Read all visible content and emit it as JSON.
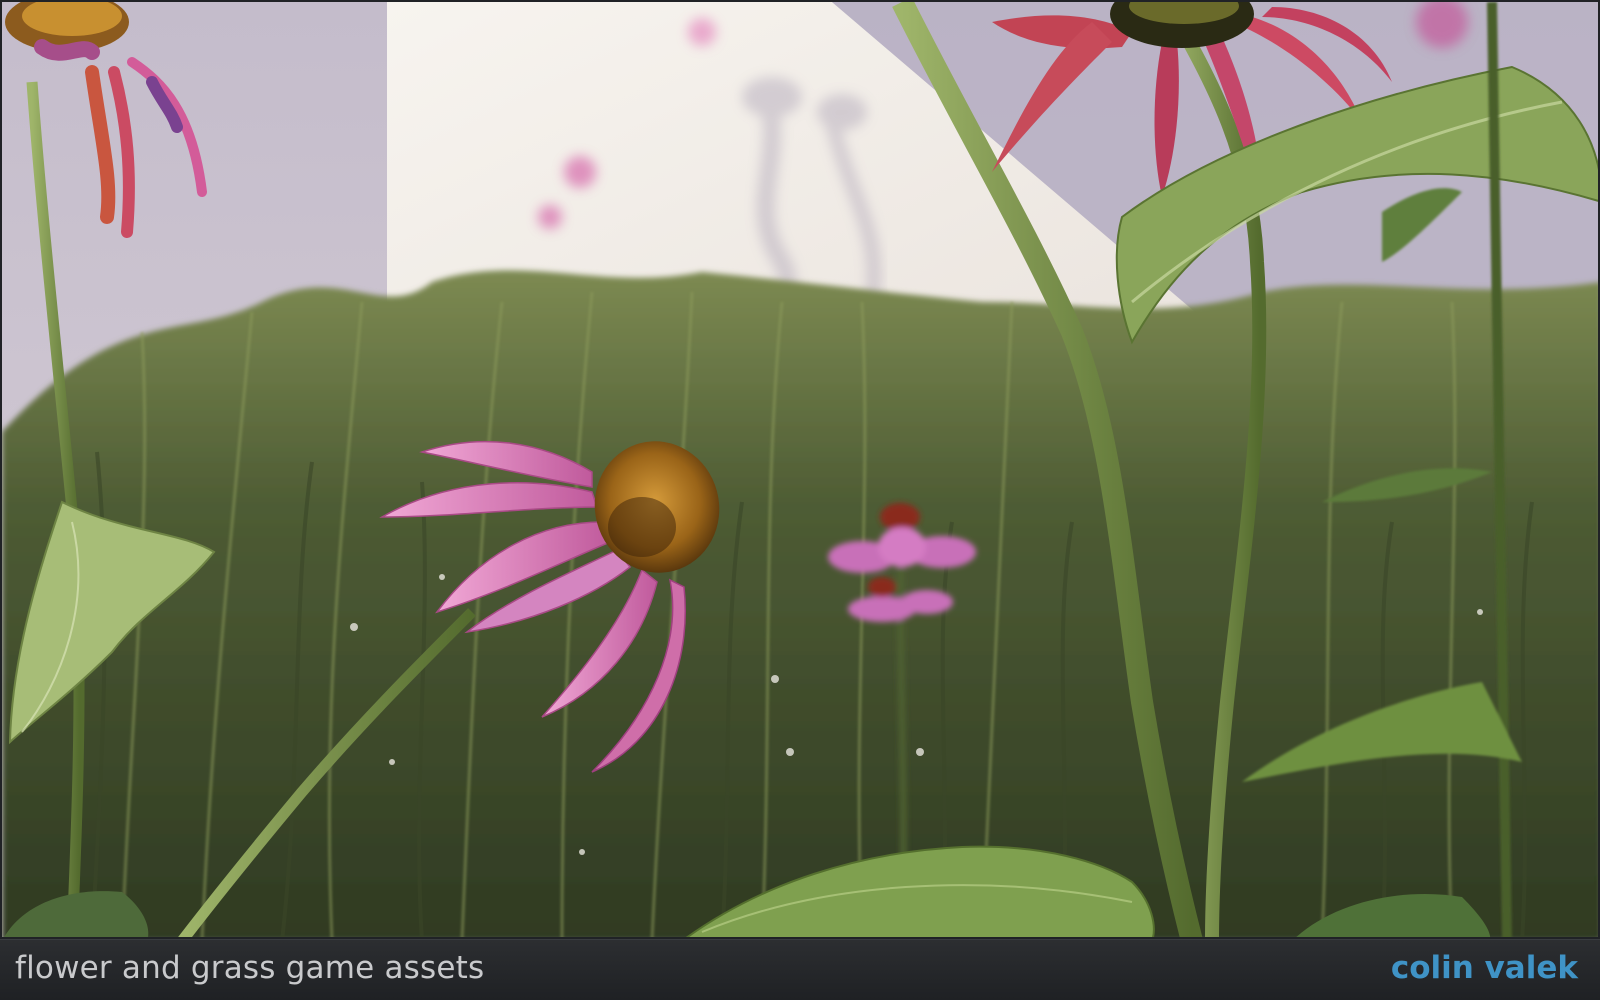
{
  "caption": {
    "title": "flower and grass game assets",
    "author": "colin valek"
  },
  "scene": {
    "subject": "coneflowers-in-grass",
    "colors": {
      "wall_lit": "#f3efe9",
      "wall_shade": "#cbc3cf",
      "grass": "#4c5a33",
      "petal": "#d86fb3",
      "cone": "#b57a22",
      "stem": "#6f8a42",
      "leaf": "#7e9a4d"
    }
  },
  "colors": {
    "caption_bg": "#26282b",
    "caption_text": "#c9cacc",
    "author_text": "#3f93c6"
  }
}
